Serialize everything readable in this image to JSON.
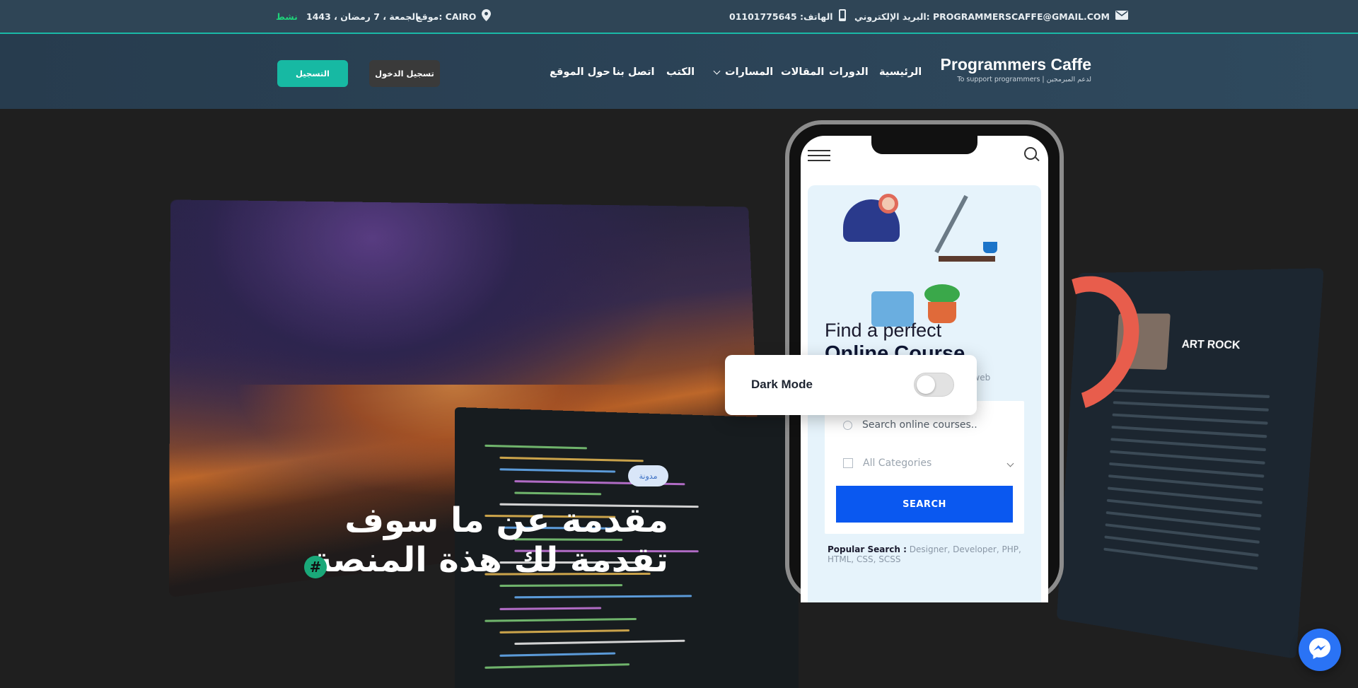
{
  "topbar": {
    "email": "البريد الإلكتروني: PROGRAMMERSCAFFE@GMAIL.COM",
    "phone": "الهاتف: 01101775645",
    "location": "موقع: CAIRO",
    "date": "الجمعة ، 7 رمضان ، 1443",
    "status": "نشط",
    "status_color": "#1fd17a"
  },
  "brand": {
    "title": "Programmers Caffe",
    "subtitle": "To support programmers | لدعم المبرمجين"
  },
  "nav": {
    "home": "الرئيسية",
    "courses": "الدورات",
    "articles": "المقالات",
    "tracks": "المسارات",
    "books": "الكتب",
    "contact": "اتصل بنا",
    "about": "حول الموقع"
  },
  "auth": {
    "login": "تسجيل الدخول",
    "signup": "التسجيل"
  },
  "phone_ui": {
    "heading_line1": "Find a perfect",
    "heading_line2": "Online Course",
    "description": "For only course you need to learn web development",
    "search_placeholder": "Search online courses..",
    "category": "All Categories",
    "search_button": "SEARCH",
    "popular_label": "Popular Search :",
    "popular_items": "Designer, Developer, PHP, HTML, CSS, SCSS"
  },
  "right_device": {
    "album_title": "ART ROCK"
  },
  "dark_mode": {
    "label": "Dark Mode",
    "enabled": false
  },
  "hero": {
    "badge": "مدونة",
    "title": "مقدمة عن ما سوف تقدمة لك هذة المنصة",
    "hash_symbol": "#"
  },
  "colors": {
    "accent": "#17b9a3",
    "topbar_bg": "#2f4556",
    "primary_button": "#0a58f0",
    "messenger": "#2a73f5"
  },
  "icons": {
    "email": "envelope-icon",
    "phone": "mobile-phone-icon",
    "location": "map-pin-icon",
    "messenger": "messenger-icon"
  }
}
